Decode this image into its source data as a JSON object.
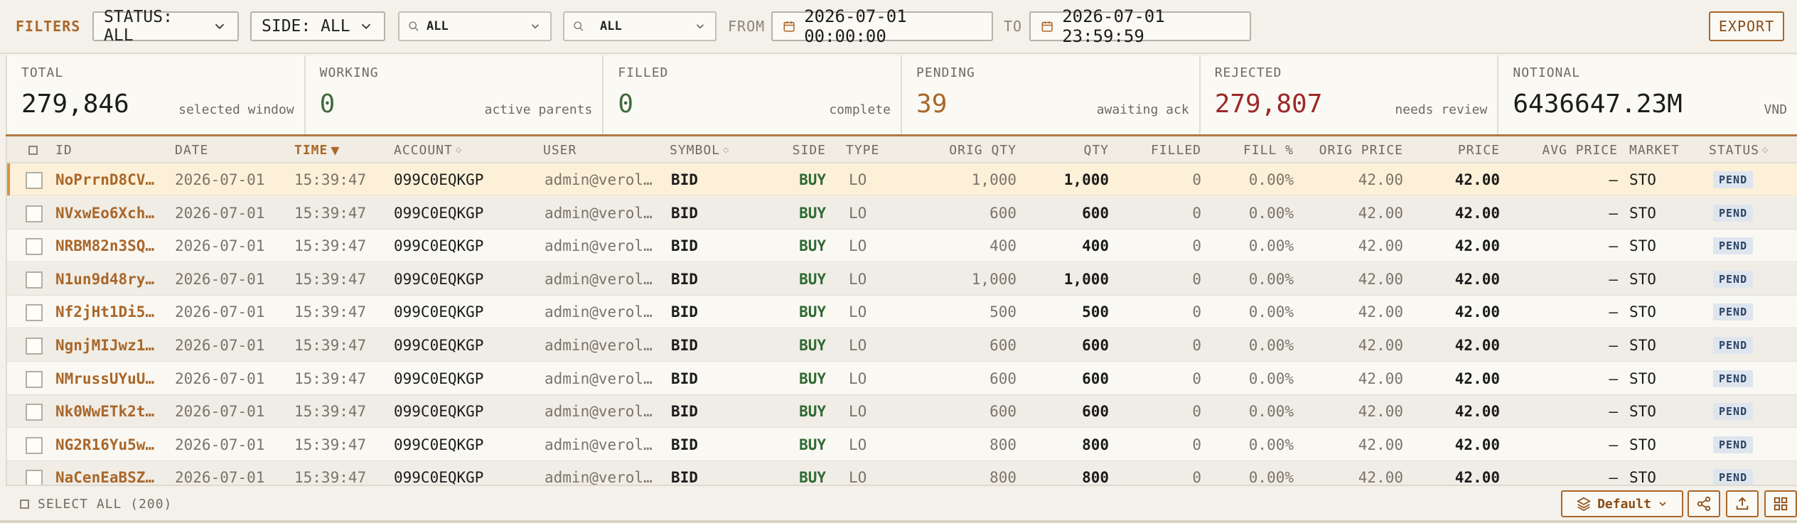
{
  "filters": {
    "label": "FILTERS",
    "status": "STATUS: ALL",
    "side": "SIDE: ALL",
    "search1": "ALL",
    "search2": "ALL",
    "from_label": "FROM",
    "from_value": "2026-07-01 00:00:00",
    "to_label": "TO",
    "to_value": "2026-07-01 23:59:59",
    "export": "EXPORT"
  },
  "stats": [
    {
      "label": "TOTAL",
      "value": "279,846",
      "sub": "selected window"
    },
    {
      "label": "WORKING",
      "value": "0",
      "sub": "active parents"
    },
    {
      "label": "FILLED",
      "value": "0",
      "sub": "complete"
    },
    {
      "label": "PENDING",
      "value": "39",
      "sub": "awaiting ack"
    },
    {
      "label": "REJECTED",
      "value": "279,807",
      "sub": "needs review"
    },
    {
      "label": "NOTIONAL",
      "value": "6436647.23M",
      "sub": "VND"
    }
  ],
  "columns": {
    "id": "ID",
    "date": "DATE",
    "time": "TIME",
    "account": "ACCOUNT",
    "user": "USER",
    "symbol": "SYMBOL",
    "side": "SIDE",
    "type": "TYPE",
    "orig_qty": "ORIG QTY",
    "qty": "QTY",
    "filled": "FILLED",
    "fill_pct": "FILL %",
    "orig_price": "ORIG PRICE",
    "price": "PRICE",
    "avg_price": "AVG PRICE",
    "market": "MARKET",
    "status": "STATUS"
  },
  "rows": [
    {
      "id": "NoPrrnD8CV…",
      "date": "2026-07-01",
      "time": "15:39:47",
      "account": "099C0EQKGP",
      "user": "admin@verol…",
      "symbol": "BID",
      "side": "BUY",
      "type": "LO",
      "orig_qty": "1,000",
      "qty": "1,000",
      "filled": "0",
      "fill_pct": "0.00%",
      "orig_price": "42.00",
      "price": "42.00",
      "avg_price": "—",
      "market": "STO",
      "status": "PEND"
    },
    {
      "id": "NVxwEo6Xch…",
      "date": "2026-07-01",
      "time": "15:39:47",
      "account": "099C0EQKGP",
      "user": "admin@verol…",
      "symbol": "BID",
      "side": "BUY",
      "type": "LO",
      "orig_qty": "600",
      "qty": "600",
      "filled": "0",
      "fill_pct": "0.00%",
      "orig_price": "42.00",
      "price": "42.00",
      "avg_price": "—",
      "market": "STO",
      "status": "PEND"
    },
    {
      "id": "NRBM82n3SQ…",
      "date": "2026-07-01",
      "time": "15:39:47",
      "account": "099C0EQKGP",
      "user": "admin@verol…",
      "symbol": "BID",
      "side": "BUY",
      "type": "LO",
      "orig_qty": "400",
      "qty": "400",
      "filled": "0",
      "fill_pct": "0.00%",
      "orig_price": "42.00",
      "price": "42.00",
      "avg_price": "—",
      "market": "STO",
      "status": "PEND"
    },
    {
      "id": "N1un9d48ry…",
      "date": "2026-07-01",
      "time": "15:39:47",
      "account": "099C0EQKGP",
      "user": "admin@verol…",
      "symbol": "BID",
      "side": "BUY",
      "type": "LO",
      "orig_qty": "1,000",
      "qty": "1,000",
      "filled": "0",
      "fill_pct": "0.00%",
      "orig_price": "42.00",
      "price": "42.00",
      "avg_price": "—",
      "market": "STO",
      "status": "PEND"
    },
    {
      "id": "Nf2jHt1Di5…",
      "date": "2026-07-01",
      "time": "15:39:47",
      "account": "099C0EQKGP",
      "user": "admin@verol…",
      "symbol": "BID",
      "side": "BUY",
      "type": "LO",
      "orig_qty": "500",
      "qty": "500",
      "filled": "0",
      "fill_pct": "0.00%",
      "orig_price": "42.00",
      "price": "42.00",
      "avg_price": "—",
      "market": "STO",
      "status": "PEND"
    },
    {
      "id": "NgnjMIJwz1…",
      "date": "2026-07-01",
      "time": "15:39:47",
      "account": "099C0EQKGP",
      "user": "admin@verol…",
      "symbol": "BID",
      "side": "BUY",
      "type": "LO",
      "orig_qty": "600",
      "qty": "600",
      "filled": "0",
      "fill_pct": "0.00%",
      "orig_price": "42.00",
      "price": "42.00",
      "avg_price": "—",
      "market": "STO",
      "status": "PEND"
    },
    {
      "id": "NMrussUYuU…",
      "date": "2026-07-01",
      "time": "15:39:47",
      "account": "099C0EQKGP",
      "user": "admin@verol…",
      "symbol": "BID",
      "side": "BUY",
      "type": "LO",
      "orig_qty": "600",
      "qty": "600",
      "filled": "0",
      "fill_pct": "0.00%",
      "orig_price": "42.00",
      "price": "42.00",
      "avg_price": "—",
      "market": "STO",
      "status": "PEND"
    },
    {
      "id": "Nk0WwETk2t…",
      "date": "2026-07-01",
      "time": "15:39:47",
      "account": "099C0EQKGP",
      "user": "admin@verol…",
      "symbol": "BID",
      "side": "BUY",
      "type": "LO",
      "orig_qty": "600",
      "qty": "600",
      "filled": "0",
      "fill_pct": "0.00%",
      "orig_price": "42.00",
      "price": "42.00",
      "avg_price": "—",
      "market": "STO",
      "status": "PEND"
    },
    {
      "id": "NG2R16Yu5w…",
      "date": "2026-07-01",
      "time": "15:39:47",
      "account": "099C0EQKGP",
      "user": "admin@verol…",
      "symbol": "BID",
      "side": "BUY",
      "type": "LO",
      "orig_qty": "800",
      "qty": "800",
      "filled": "0",
      "fill_pct": "0.00%",
      "orig_price": "42.00",
      "price": "42.00",
      "avg_price": "—",
      "market": "STO",
      "status": "PEND"
    },
    {
      "id": "NaCenEaBSZ…",
      "date": "2026-07-01",
      "time": "15:39:47",
      "account": "099C0EQKGP",
      "user": "admin@verol…",
      "symbol": "BID",
      "side": "BUY",
      "type": "LO",
      "orig_qty": "800",
      "qty": "800",
      "filled": "0",
      "fill_pct": "0.00%",
      "orig_price": "42.00",
      "price": "42.00",
      "avg_price": "—",
      "market": "STO",
      "status": "PEND"
    }
  ],
  "footer": {
    "select_all": "SELECT ALL (200)",
    "view_label": "Default"
  },
  "icons": {
    "chevron": "chevron-down-icon",
    "search": "search-icon",
    "calendar": "calendar-icon",
    "layers": "layers-icon",
    "share": "share-icon",
    "upload": "upload-icon",
    "grid": "grid-icon"
  },
  "colors": {
    "accent": "#a9672a",
    "buy": "#2f6a33",
    "rejected": "#9b2a2a",
    "working": "#3f6a3d",
    "pending": "#a9672a",
    "badge_bg": "#dfe5ee"
  }
}
